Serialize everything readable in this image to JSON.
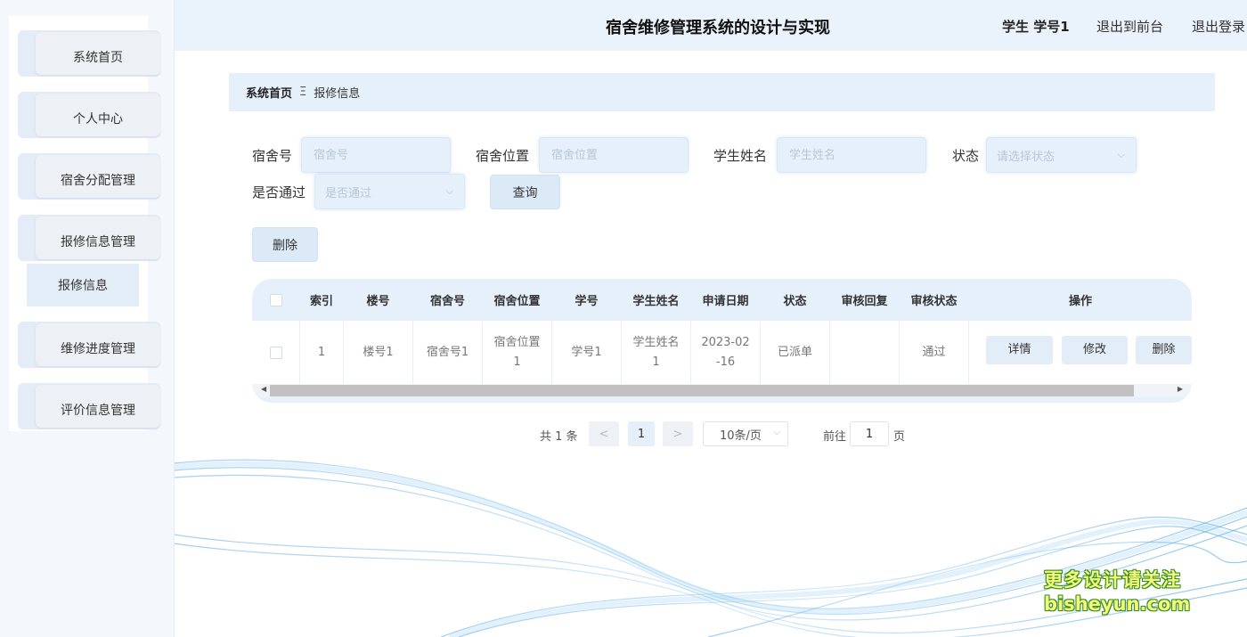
{
  "header": {
    "title": "宿舍维修管理系统的设计与实现",
    "user": "学生 学号1",
    "to_front": "退出到前台",
    "logout": "退出登录"
  },
  "sidebar": {
    "items": [
      {
        "label": "系统首页"
      },
      {
        "label": "个人中心"
      },
      {
        "label": "宿舍分配管理"
      },
      {
        "label": "报修信息管理"
      },
      {
        "label": "维修进度管理"
      },
      {
        "label": "评价信息管理"
      }
    ],
    "submenu": {
      "label": "报修信息"
    }
  },
  "breadcrumb": {
    "home": "系统首页",
    "separator": "Ξ",
    "current": "报修信息"
  },
  "search": {
    "dorm_no": {
      "label": "宿舍号",
      "placeholder": "宿舍号"
    },
    "dorm_location": {
      "label": "宿舍位置",
      "placeholder": "宿舍位置"
    },
    "student_name": {
      "label": "学生姓名",
      "placeholder": "学生姓名"
    },
    "status": {
      "label": "状态",
      "placeholder": "请选择状态"
    },
    "passed": {
      "label": "是否通过",
      "placeholder": "是否通过"
    },
    "query_button": "查询"
  },
  "actions": {
    "delete_button": "删除"
  },
  "table": {
    "columns": [
      "索引",
      "楼号",
      "宿舍号",
      "宿舍位置",
      "学号",
      "学生姓名",
      "申请日期",
      "状态",
      "审核回复",
      "审核状态",
      "操作"
    ],
    "rows": [
      {
        "index": "1",
        "building": "楼号1",
        "dorm_no": "宿舍号1",
        "location_l1": "宿舍位置",
        "location_l2": "1",
        "student_no": "学号1",
        "name_l1": "学生姓名",
        "name_l2": "1",
        "date_l1": "2023-02",
        "date_l2": "-16",
        "status": "已派单",
        "reply": "",
        "audit_status": "通过",
        "btn_detail": "详情",
        "btn_edit": "修改",
        "btn_delete": "删除"
      }
    ]
  },
  "pagination": {
    "total": "共 1 条",
    "prev": "<",
    "current": "1",
    "next": ">",
    "page_size": "10条/页",
    "goto_prefix": "前往",
    "goto_value": "1",
    "goto_suffix": "页"
  },
  "watermark": {
    "line1": "更多设计请关注",
    "line2": "bisheyun.com"
  },
  "colors": {
    "accent_light": "#e6f0fb",
    "button": "#dce9f7",
    "sidebar_bg": "#f4f8fc"
  }
}
